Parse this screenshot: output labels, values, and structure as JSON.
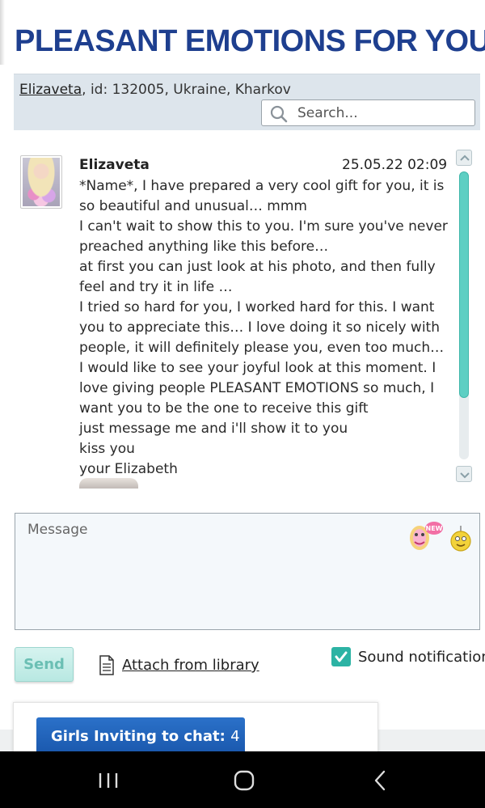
{
  "header": {
    "title": "PLEASANT EMOTIONS FOR YOU"
  },
  "profile": {
    "name_link": "Elizaveta",
    "details": ", id: 132005, Ukraine, Kharkov"
  },
  "search": {
    "placeholder": "Search..."
  },
  "message": {
    "sender": "Elizaveta",
    "timestamp": "25.05.22 02:09",
    "lines": [
      "*Name*, I have prepared a very cool gift for you, it is so beautiful and unusual… mmm",
      "I can't wait to show this to you. I'm sure you've never preached anything like this before…",
      "at first you can just look at his photo, and then fully feel and try it in life …",
      "I tried so hard for you, I worked hard for this. I want you to appreciate this… I love doing it so nicely with people, it will definitely please you, even too much… I would like to see your joyful look at this moment. I love giving people PLEASANT EMOTIONS so much, I want you to be the one to receive this gift",
      "just message me and i'll show it to you",
      "kiss you",
      "your Elizabeth"
    ]
  },
  "compose": {
    "placeholder": "Message",
    "sticker_badge": "NEW"
  },
  "actions": {
    "send_label": "Send",
    "attach_label": "Attach from library",
    "sound_label": "Sound notification",
    "sound_checked": true
  },
  "invite": {
    "label": "Girls Inviting to chat:",
    "count": "4"
  },
  "colors": {
    "title": "#1e3f8f",
    "accent_teal": "#2cb3a4",
    "invite_button": "#1a58ad"
  },
  "icons": {
    "search": "search-icon",
    "sticker": "sticker-icon",
    "emoji": "emoji-icon",
    "attach": "document-icon",
    "recents": "recents-icon",
    "home": "home-icon",
    "back": "back-icon"
  }
}
